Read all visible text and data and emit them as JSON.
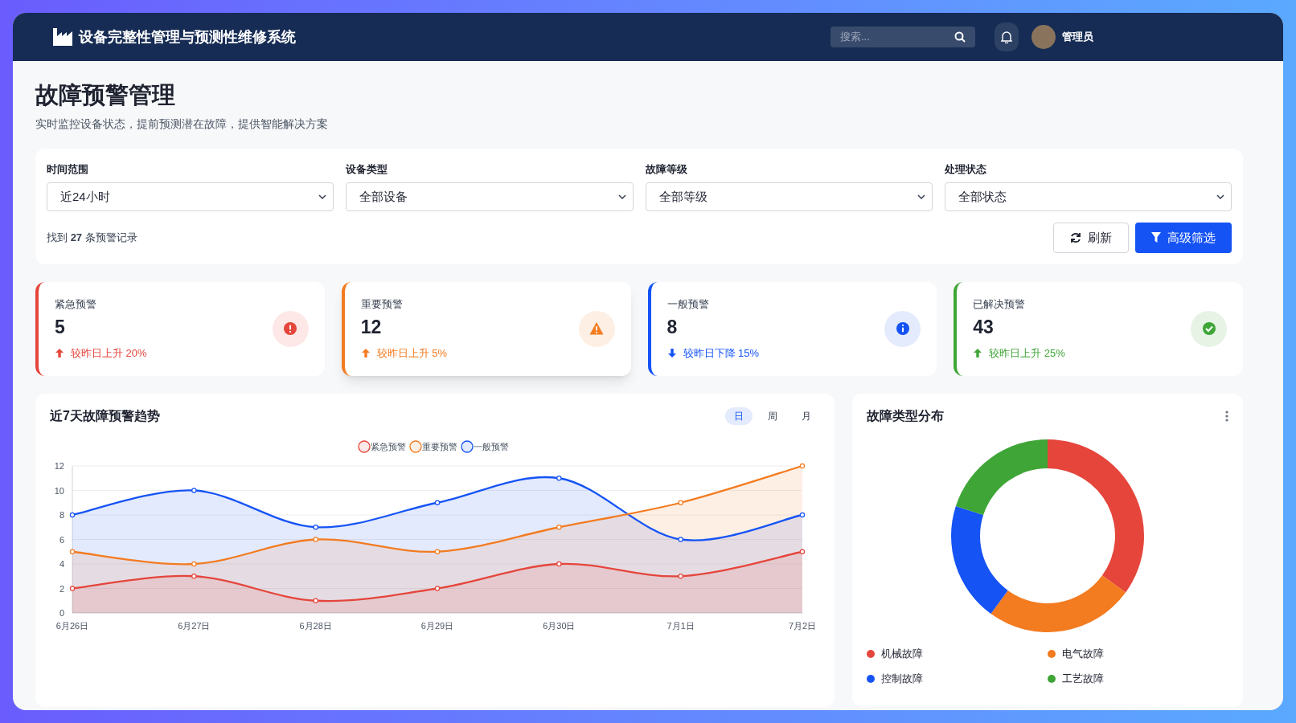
{
  "header": {
    "title": "设备完整性管理与预测性维修系统",
    "search": {
      "placeholder": "搜索..."
    },
    "user": "管理员"
  },
  "page": {
    "title": "故障预警管理",
    "subtitle": "实时监控设备状态，提前预测潜在故障，提供智能解决方案"
  },
  "filters": [
    {
      "label": "时间范围",
      "value": "近24小时"
    },
    {
      "label": "设备类型",
      "value": "全部设备"
    },
    {
      "label": "故障等级",
      "value": "全部等级"
    },
    {
      "label": "处理状态",
      "value": "全部状态"
    }
  ],
  "result_text": "找到 **27** 条预警记录",
  "buttons": [
    {
      "kind": "refresh",
      "label": "刷新"
    },
    {
      "kind": "filter",
      "label": "高级筛选"
    }
  ],
  "stats": [
    {
      "kind": "danger",
      "label": "紧急预警",
      "value": "5",
      "rising": true,
      "change": "较昨日上升 20%",
      "color": "#e5453b"
    },
    {
      "kind": "warning",
      "label": "重要预警",
      "value": "12",
      "rising": true,
      "change": "较昨日上升 5%",
      "color": "#f37b20"
    },
    {
      "kind": "info",
      "label": "一般预警",
      "value": "8",
      "rising": false,
      "change": "较昨日下降 15%",
      "color": "#1553f5"
    },
    {
      "kind": "success",
      "label": "已解决预警",
      "value": "43",
      "rising": true,
      "change": "较昨日上升 25%",
      "color": "#3ea536"
    }
  ],
  "trend_card": {
    "title": "近7天故障预警趋势",
    "tabs": [
      {
        "label": "日",
        "selected": true
      },
      {
        "label": "周",
        "selected": false
      },
      {
        "label": "月",
        "selected": false
      }
    ],
    "chart_data": {
      "type": "area",
      "grid": true,
      "legend": true,
      "categories": [
        "6月26日",
        "6月27日",
        "6月28日",
        "6月29日",
        "6月30日",
        "7月1日",
        "7月2日"
      ],
      "ylim": [
        0,
        12
      ],
      "yticks": [
        {
          "value": 0,
          "label": "0"
        },
        {
          "value": 2,
          "label": "2"
        },
        {
          "value": 4,
          "label": "4"
        },
        {
          "value": 6,
          "label": "6"
        },
        {
          "value": 8,
          "label": "8"
        },
        {
          "value": 10,
          "label": "10"
        },
        {
          "value": 12,
          "label": "12"
        }
      ],
      "series": [
        {
          "name": "紧急预警",
          "color": "#e5453b",
          "values": [
            2,
            3,
            1,
            2,
            4,
            3,
            5
          ]
        },
        {
          "name": "重要预警",
          "color": "#f37b20",
          "values": [
            5,
            4,
            6,
            5,
            7,
            9,
            12
          ]
        },
        {
          "name": "一般预警",
          "color": "#1553f5",
          "values": [
            8,
            10,
            7,
            9,
            11,
            6,
            8
          ]
        }
      ]
    }
  },
  "type_card": {
    "title": "故障类型分布",
    "legend": [
      {
        "label": "机械故障",
        "color": "#e5453b"
      },
      {
        "label": "电气故障",
        "color": "#f37b20"
      },
      {
        "label": "控制故障",
        "color": "#1553f5"
      },
      {
        "label": "工艺故障",
        "color": "#3ea536"
      }
    ]
  }
}
